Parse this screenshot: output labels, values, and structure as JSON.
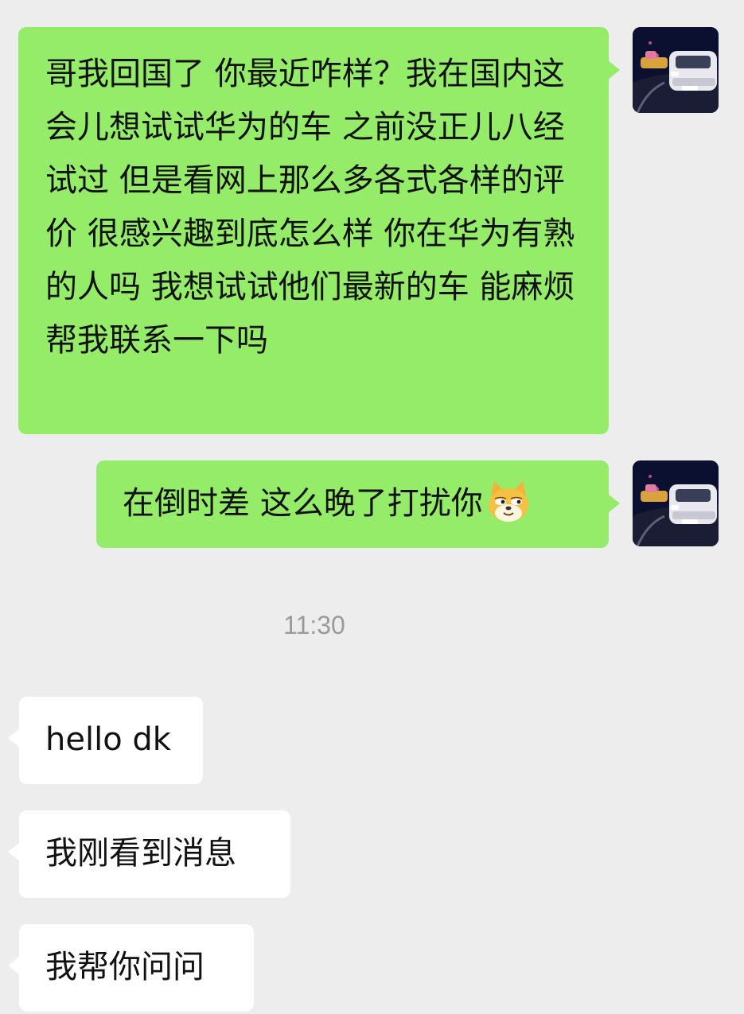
{
  "messages": {
    "m1": {
      "text": "哥我回国了 你最近咋样？我在国内这会儿想试试华为的车 之前没正儿八经试过 但是看网上那么多各式各样的评价 很感兴趣到底怎么样 你在华为有熟的人吗 我想试试他们最新的车 能麻烦帮我联系一下吗",
      "direction": "outgoing"
    },
    "m2": {
      "text": "在倒时差 这么晚了打扰你",
      "emoji": "doge-emoji",
      "direction": "outgoing"
    },
    "timestamp": "11:30",
    "m3": {
      "text": "hello dk",
      "direction": "incoming"
    },
    "m4": {
      "text": "我刚看到消息",
      "direction": "incoming"
    },
    "m5": {
      "text": "我帮你问问",
      "direction": "incoming"
    }
  },
  "colors": {
    "background": "#ededed",
    "outgoing_bubble": "#95ec69",
    "incoming_bubble": "#ffffff",
    "timestamp_text": "#9a9a9a"
  },
  "avatar": {
    "icon": "car-night-avatar-icon"
  }
}
